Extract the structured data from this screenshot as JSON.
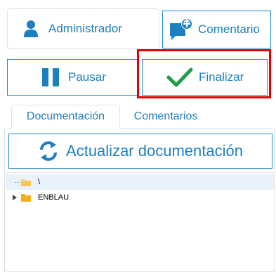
{
  "user": {
    "name": "Administrador",
    "icon": "user-icon"
  },
  "actions": {
    "comment_label": "Comentario",
    "pause_label": "Pausar",
    "finish_label": "Finalizar"
  },
  "tabs": [
    {
      "label": "Documentación",
      "active": true
    },
    {
      "label": "Comentarios",
      "active": false
    }
  ],
  "refresh_label": "Actualizar documentación",
  "tree": [
    {
      "label": "\\",
      "expanded": true,
      "selected": true
    },
    {
      "label": "ENBLAU",
      "expanded": false,
      "selected": false
    }
  ],
  "colors": {
    "accent": "#1b7fc0",
    "highlight": "#e00000",
    "check": "#1f9e45",
    "folder": "#f2b01e"
  }
}
